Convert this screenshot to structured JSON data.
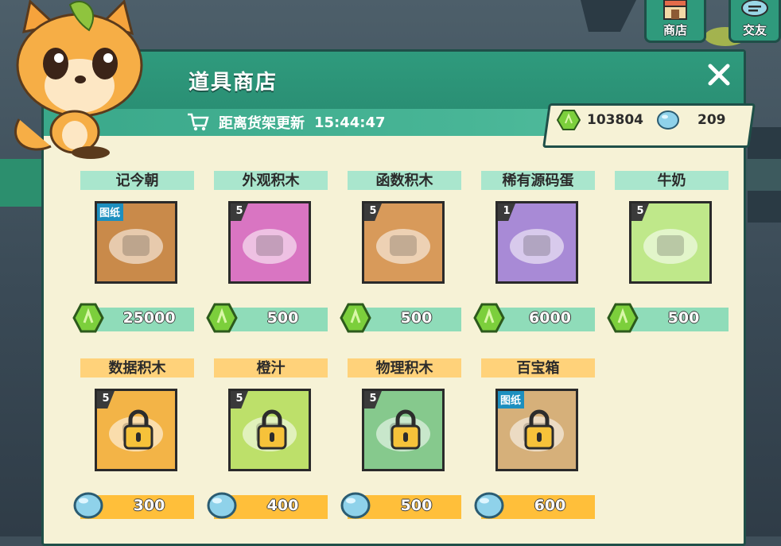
{
  "header": {
    "title": "道具商店",
    "refresh_label": "距离货架更新",
    "refresh_time": "15:44:47"
  },
  "top_buttons": [
    {
      "label": "商店",
      "icon": "shop-icon"
    },
    {
      "label": "交友",
      "icon": "chat-icon"
    }
  ],
  "currency": {
    "green_gem": "103804",
    "blue_orb": "209"
  },
  "colors": {
    "teal": "#2f9b7d",
    "panel_bg": "#f6f2d6",
    "green_price_bar": "#8fdcb9",
    "orange_price_bar": "#ffbf3a"
  },
  "items": [
    {
      "name": "记今朝",
      "price": "25000",
      "currency": "green-gem",
      "badge": "图纸",
      "icon": "wooden-shelf-blueprint-icon",
      "locked": false
    },
    {
      "name": "外观积木",
      "price": "500",
      "currency": "green-gem",
      "qty": "5",
      "icon": "looks-block-icon",
      "locked": false
    },
    {
      "name": "函数积木",
      "price": "500",
      "currency": "green-gem",
      "qty": "5",
      "icon": "procedure-block-icon",
      "locked": false
    },
    {
      "name": "稀有源码蛋",
      "price": "6000",
      "currency": "green-gem",
      "qty": "1",
      "icon": "rare-code-egg-icon",
      "locked": false
    },
    {
      "name": "牛奶",
      "price": "500",
      "currency": "green-gem",
      "qty": "5",
      "icon": "milk-carton-icon",
      "locked": false
    },
    {
      "name": "数据积木",
      "price": "300",
      "currency": "blue-orb",
      "qty": "5",
      "icon": "data-block-icon",
      "locked": true
    },
    {
      "name": "橙汁",
      "price": "400",
      "currency": "blue-orb",
      "qty": "5",
      "icon": "orange-juice-icon",
      "locked": true
    },
    {
      "name": "物理积木",
      "price": "500",
      "currency": "blue-orb",
      "qty": "5",
      "icon": "physics-block-icon",
      "locked": true
    },
    {
      "name": "百宝箱",
      "price": "600",
      "currency": "blue-orb",
      "badge": "图纸",
      "icon": "treasure-chest-blueprint-icon",
      "locked": true
    }
  ]
}
